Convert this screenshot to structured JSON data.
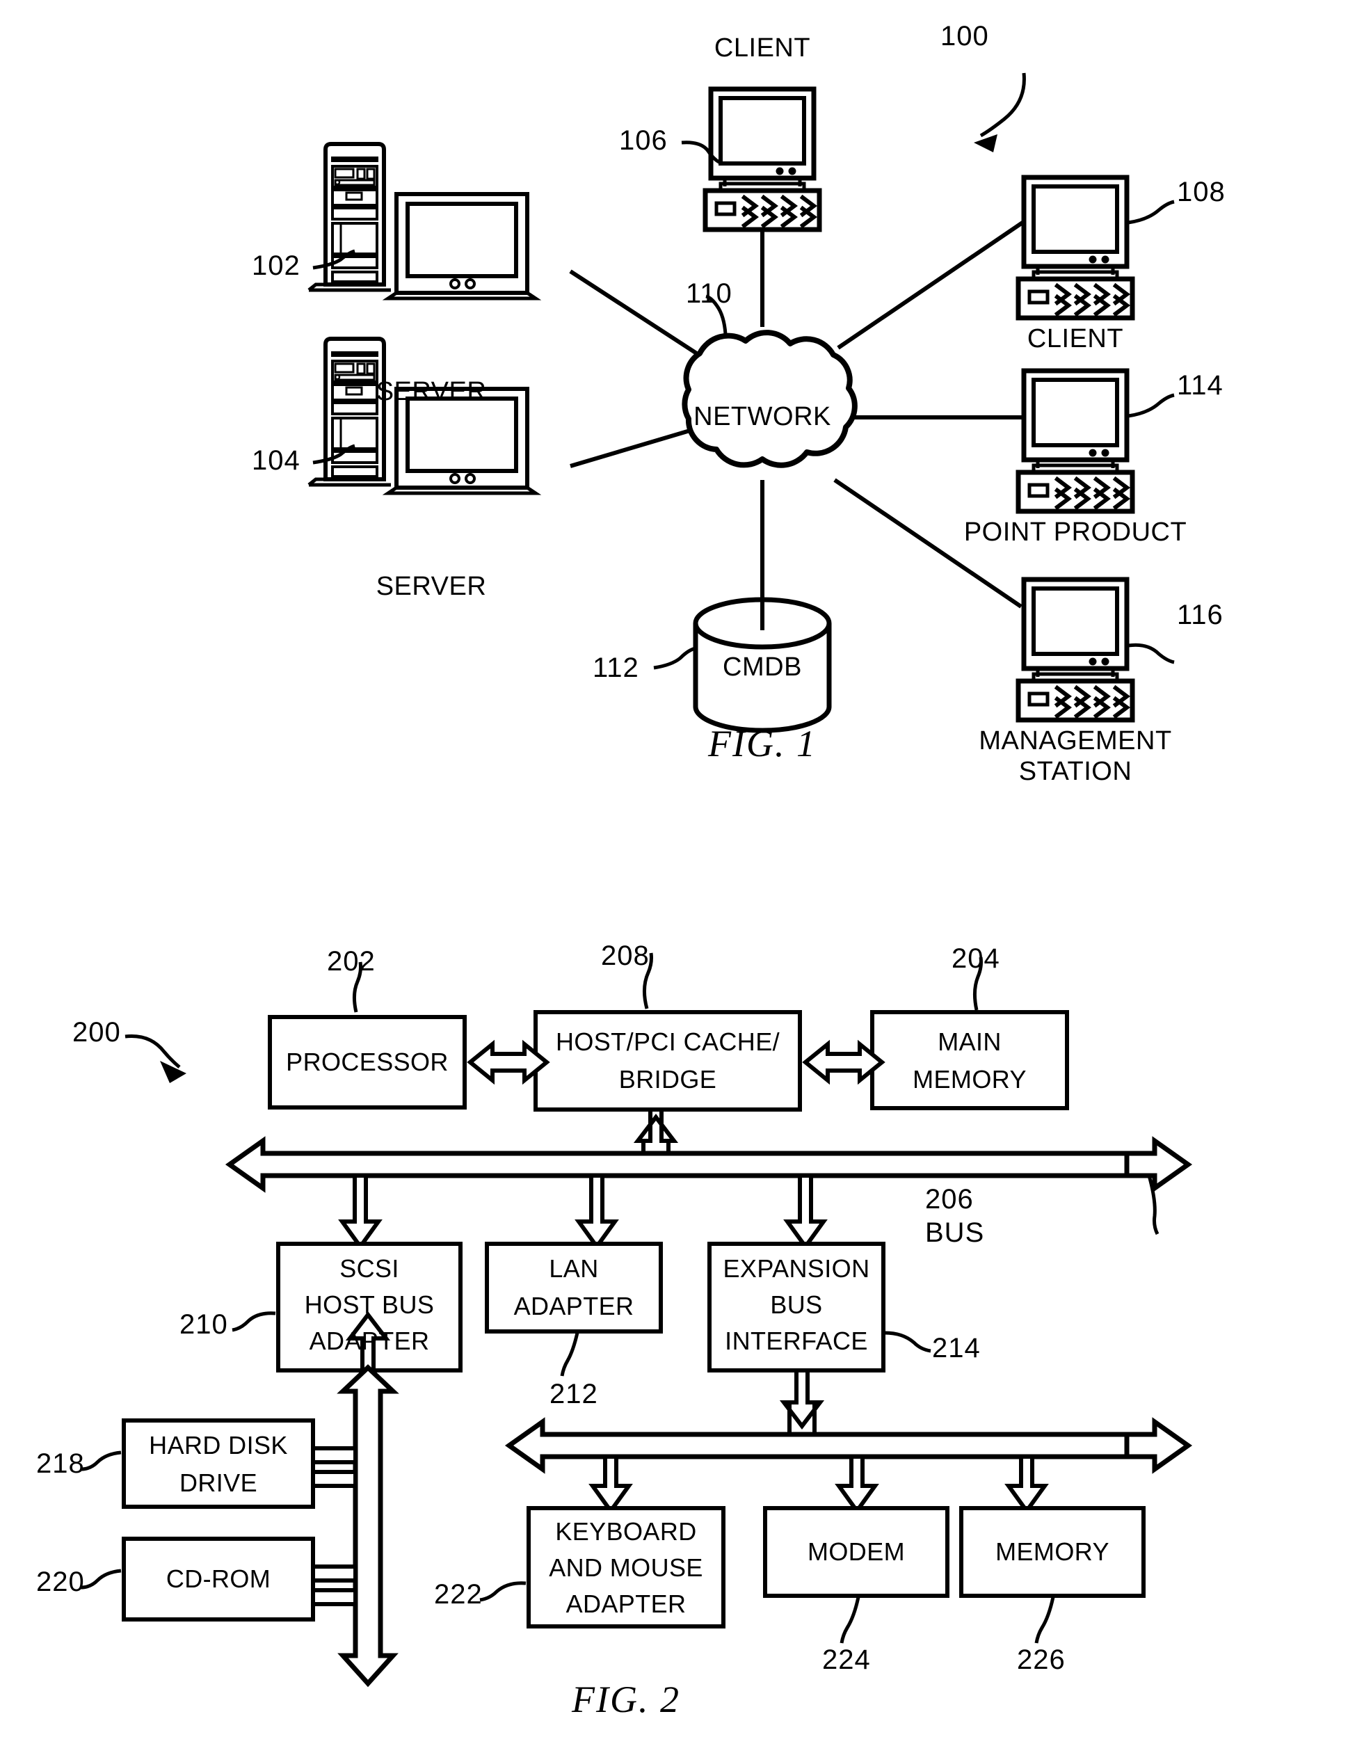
{
  "figure1": {
    "caption": "FIG. 1",
    "system_ref": "100",
    "nodes": [
      {
        "ref": "102",
        "label": "SERVER",
        "icon": "server-tower-and-monitor-icon"
      },
      {
        "ref": "104",
        "label": "SERVER",
        "icon": "server-tower-and-monitor-icon"
      },
      {
        "ref": "106",
        "label": "CLIENT",
        "icon": "desktop-computer-icon"
      },
      {
        "ref": "108",
        "label": "CLIENT",
        "icon": "desktop-computer-icon"
      },
      {
        "ref": "114",
        "label": "POINT PRODUCT",
        "icon": "desktop-computer-icon"
      },
      {
        "ref": "116",
        "label": "MANAGEMENT\nSTATION",
        "icon": "desktop-computer-icon"
      },
      {
        "ref": "110",
        "label": "NETWORK",
        "icon": "network-cloud-icon"
      },
      {
        "ref": "112",
        "label": "CMDB",
        "icon": "database-cylinder-icon"
      }
    ],
    "labels": {
      "server_top": "SERVER",
      "server_bottom": "SERVER",
      "client_top": "CLIENT",
      "client_right": "CLIENT",
      "point_product": "POINT PRODUCT",
      "management_station_line1": "MANAGEMENT",
      "management_station_line2": "STATION",
      "network": "NETWORK",
      "cmdb": "CMDB"
    },
    "refs": {
      "r100": "100",
      "r102": "102",
      "r104": "104",
      "r106": "106",
      "r108": "108",
      "r110": "110",
      "r112": "112",
      "r114": "114",
      "r116": "116"
    }
  },
  "figure2": {
    "caption": "FIG. 2",
    "system_ref": "200",
    "blocks": [
      {
        "ref": "202",
        "label": "PROCESSOR"
      },
      {
        "ref": "208",
        "label": "HOST/PCI CACHE/\nBRIDGE"
      },
      {
        "ref": "204",
        "label": "MAIN\nMEMORY"
      },
      {
        "ref": "210",
        "label": "SCSI\nHOST BUS\nADAPTER"
      },
      {
        "ref": "212",
        "label": "LAN\nADAPTER"
      },
      {
        "ref": "214",
        "label": "EXPANSION\nBUS\nINTERFACE"
      },
      {
        "ref": "218",
        "label": "HARD DISK\nDRIVE"
      },
      {
        "ref": "220",
        "label": "CD-ROM"
      },
      {
        "ref": "222",
        "label": "KEYBOARD\nAND MOUSE\nADAPTER"
      },
      {
        "ref": "224",
        "label": "MODEM"
      },
      {
        "ref": "226",
        "label": "MEMORY"
      }
    ],
    "bus": {
      "ref": "206",
      "label": "BUS"
    },
    "block_text": {
      "processor": "PROCESSOR",
      "host_pci_l1": "HOST/PCI CACHE/",
      "host_pci_l2": "BRIDGE",
      "main_memory_l1": "MAIN",
      "main_memory_l2": "MEMORY",
      "scsi_l1": "SCSI",
      "scsi_l2": "HOST BUS",
      "scsi_l3": "ADAPTER",
      "lan_l1": "LAN",
      "lan_l2": "ADAPTER",
      "exp_l1": "EXPANSION",
      "exp_l2": "BUS",
      "exp_l3": "INTERFACE",
      "hdd_l1": "HARD DISK",
      "hdd_l2": "DRIVE",
      "cdrom": "CD-ROM",
      "kbm_l1": "KEYBOARD",
      "kbm_l2": "AND MOUSE",
      "kbm_l3": "ADAPTER",
      "modem": "MODEM",
      "memory": "MEMORY",
      "bus_num": "206",
      "bus_word": "BUS"
    },
    "refs": {
      "r200": "200",
      "r202": "202",
      "r204": "204",
      "r206": "206",
      "r208": "208",
      "r210": "210",
      "r212": "212",
      "r214": "214",
      "r218": "218",
      "r220": "220",
      "r222": "222",
      "r224": "224",
      "r226": "226"
    }
  },
  "colors": {
    "ink": "#000000",
    "paper": "#ffffff"
  }
}
